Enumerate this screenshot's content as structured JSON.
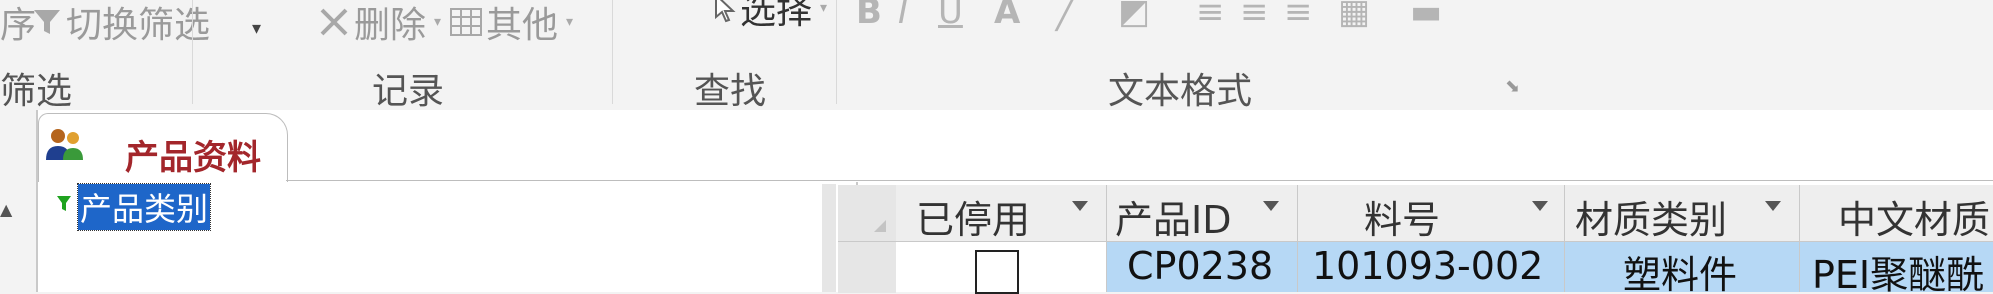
{
  "ribbon": {
    "sort_partial": "序",
    "toggle_filter": "切换筛选",
    "refresh_dd": "▾",
    "delete": "删除",
    "other": "其他",
    "select": "选择",
    "groups": {
      "filter": "筛选",
      "records": "记录",
      "find": "查找",
      "text_format": "文本格式"
    }
  },
  "document_tab": {
    "title": "产品资料"
  },
  "tree": {
    "selected_node": "产品类别"
  },
  "datasheet": {
    "columns": [
      "已停用",
      "产品ID",
      "料号",
      "材质类别",
      "中文材质"
    ],
    "rows": [
      {
        "disabled": false,
        "product_id": "CP0238",
        "part_no": "101093-002",
        "material_type": "塑料件",
        "material_cn": "PEI聚醚酰"
      }
    ]
  }
}
